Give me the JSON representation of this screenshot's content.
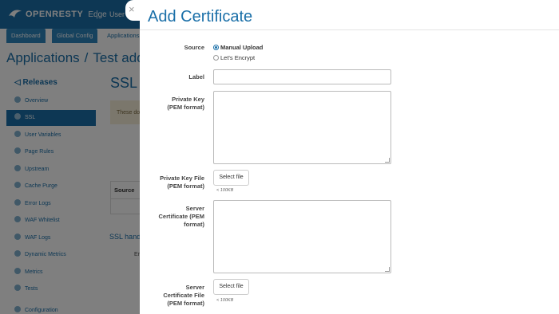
{
  "app": {
    "logo_text": "OPENRESTY",
    "logo_suffix": "Edge",
    "top_menu_item": "User &",
    "tabs": [
      "Dashboard",
      "Global Config",
      "Applications"
    ],
    "breadcrumb": [
      "Applications",
      "Test add"
    ],
    "sidebar": {
      "section": "Releases",
      "items": [
        "Overview",
        "SSL",
        "User Variables",
        "Page Rules",
        "Upstream",
        "Cache Purge",
        "Error Logs",
        "WAF Whitelist",
        "WAF Logs",
        "Dynamic Metrics",
        "Metrics",
        "Tests",
        "Configuration"
      ],
      "active_index": 1
    },
    "main": {
      "title": "SSL",
      "notice": "These do",
      "table_header": "Source",
      "subheading": "SSL hand",
      "error_text": "Er"
    }
  },
  "drawer": {
    "close_label": "×",
    "title": "Add Certificate",
    "source": {
      "label": "Source",
      "options": [
        "Manual Upload",
        "Let's Encrypt"
      ],
      "selected": "Manual Upload"
    },
    "label_field": {
      "label": "Label",
      "value": "",
      "placeholder": ""
    },
    "private_key": {
      "label_line1": "Private Key",
      "label_line2": "(PEM format)",
      "value": ""
    },
    "private_key_file": {
      "label_line1": "Private Key File",
      "label_line2": "(PEM format)",
      "button": "Select file",
      "hint": "< 100KB"
    },
    "server_cert": {
      "label_line1": "Server",
      "label_line2": "Certificate (PEM",
      "label_line3": "format)",
      "value": ""
    },
    "server_cert_file": {
      "label_line1": "Server",
      "label_line2": "Certificate File",
      "label_line3": "(PEM format)",
      "button": "Select file",
      "hint": "< 100KB"
    }
  },
  "colors": {
    "accent": "#1a6fa8",
    "overlay": "rgba(0,0,0,0.5)"
  }
}
